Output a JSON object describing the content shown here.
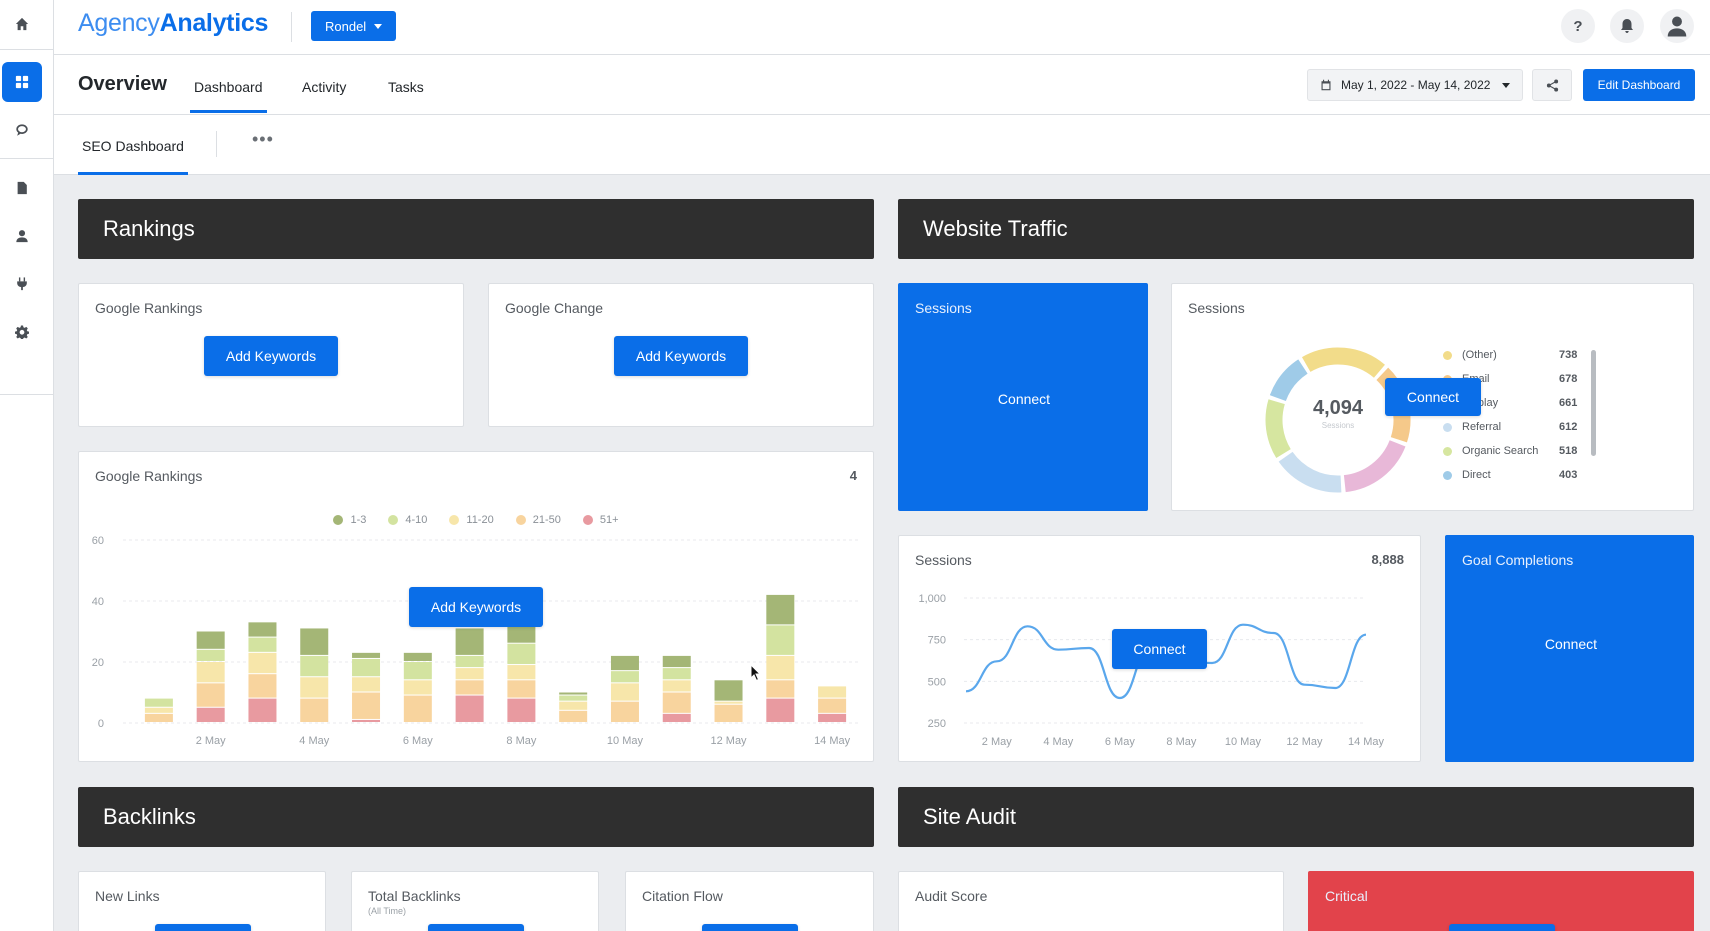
{
  "app": {
    "logo_light": "Agency",
    "logo_bold": "Analytics",
    "client": "Rondel"
  },
  "sidebar": {
    "items": [
      "home-icon",
      "dashboard-icon",
      "chat-icon",
      "report-icon",
      "user-icon",
      "plug-icon",
      "gear-icon"
    ]
  },
  "header": {
    "help": "?"
  },
  "nav": {
    "title": "Overview",
    "tabs": [
      "Dashboard",
      "Activity",
      "Tasks"
    ],
    "date_range": "May 1, 2022 - May 14, 2022",
    "edit_label": "Edit Dashboard"
  },
  "subnav": {
    "tab": "SEO Dashboard",
    "more": "•••"
  },
  "sections": {
    "rankings": "Rankings",
    "traffic": "Website Traffic",
    "backlinks": "Backlinks",
    "audit": "Site Audit"
  },
  "cards": {
    "google_rankings": {
      "title": "Google Rankings",
      "button": "Add Keywords"
    },
    "google_change": {
      "title": "Google Change",
      "button": "Add Keywords"
    },
    "rankings_chart": {
      "title": "Google Rankings",
      "value": "4",
      "button": "Add Keywords"
    },
    "sessions_blue": {
      "title": "Sessions",
      "button": "Connect"
    },
    "sessions_donut": {
      "title": "Sessions",
      "center": "4,094",
      "center_sub": "Sessions",
      "button": "Connect"
    },
    "sessions_line": {
      "title": "Sessions",
      "value": "8,888",
      "button": "Connect"
    },
    "goal": {
      "title": "Goal Completions",
      "button": "Connect"
    },
    "new_links": {
      "title": "New Links"
    },
    "total_backlinks": {
      "title": "Total Backlinks",
      "sub": "(All Time)"
    },
    "citation_flow": {
      "title": "Citation Flow"
    },
    "audit_score": {
      "title": "Audit Score"
    },
    "critical": {
      "title": "Critical"
    }
  },
  "donut_legend": [
    {
      "label": "(Other)",
      "value": "738",
      "color": "#f2dc8a"
    },
    {
      "label": "Email",
      "value": "678",
      "color": "#f5c98a"
    },
    {
      "label": "Display",
      "value": "661",
      "color": "#e8b8d8"
    },
    {
      "label": "Referral",
      "value": "612",
      "color": "#c9def0"
    },
    {
      "label": "Organic Search",
      "value": "518",
      "color": "#d6e6a0"
    },
    {
      "label": "Direct",
      "value": "403",
      "color": "#9fcbe8"
    }
  ],
  "chart_data": [
    {
      "type": "bar",
      "title": "Google Rankings",
      "categories": [
        "1 May",
        "2 May",
        "3 May",
        "4 May",
        "5 May",
        "6 May",
        "7 May",
        "8 May",
        "9 May",
        "10 May",
        "11 May",
        "12 May",
        "13 May",
        "14 May"
      ],
      "x_tick_labels": [
        "2 May",
        "4 May",
        "6 May",
        "8 May",
        "10 May",
        "12 May",
        "14 May"
      ],
      "ylim": [
        0,
        60
      ],
      "y_ticks": [
        "0",
        "20",
        "40",
        "60"
      ],
      "series": [
        {
          "name": "51+",
          "color": "#e89aa0",
          "values": [
            0,
            5,
            8,
            0,
            1,
            0,
            9,
            8,
            0,
            0,
            3,
            0,
            8,
            3
          ]
        },
        {
          "name": "21-50",
          "color": "#f8d49e",
          "values": [
            3,
            8,
            8,
            8,
            9,
            9,
            5,
            6,
            4,
            7,
            7,
            6,
            6,
            5
          ]
        },
        {
          "name": "11-20",
          "color": "#f7e6aa",
          "values": [
            2,
            7,
            7,
            7,
            5,
            5,
            4,
            5,
            3,
            6,
            4,
            1,
            8,
            4
          ]
        },
        {
          "name": "4-10",
          "color": "#d3e3a0",
          "values": [
            3,
            4,
            5,
            7,
            6,
            6,
            4,
            7,
            2,
            4,
            4,
            0,
            10,
            0
          ]
        },
        {
          "name": "1-3",
          "color": "#a4b676",
          "values": [
            0,
            6,
            5,
            9,
            2,
            3,
            9,
            7,
            1,
            5,
            4,
            7,
            10,
            0
          ]
        }
      ],
      "legend_order": [
        "1-3",
        "4-10",
        "11-20",
        "21-50",
        "51+"
      ],
      "legend": "top"
    },
    {
      "type": "line",
      "title": "Sessions",
      "x_tick_labels": [
        "2 May",
        "4 May",
        "6 May",
        "8 May",
        "10 May",
        "12 May",
        "14 May"
      ],
      "x": [
        "1 May",
        "2 May",
        "3 May",
        "4 May",
        "5 May",
        "6 May",
        "7 May",
        "8 May",
        "9 May",
        "10 May",
        "11 May",
        "12 May",
        "13 May",
        "14 May"
      ],
      "y_ticks": [
        "250",
        "500",
        "750",
        "1,000"
      ],
      "ylim": [
        250,
        1000
      ],
      "series": [
        {
          "values": [
            440,
            620,
            830,
            690,
            700,
            400,
            700,
            620,
            610,
            840,
            790,
            480,
            460,
            780
          ],
          "color": "#5aa7ec"
        }
      ]
    },
    {
      "type": "pie",
      "title": "Sessions",
      "categories": [
        "(Other)",
        "Email",
        "Display",
        "Referral",
        "Organic Search",
        "Direct"
      ],
      "values": [
        738,
        678,
        661,
        612,
        518,
        403
      ],
      "center_label": "4,094"
    }
  ]
}
